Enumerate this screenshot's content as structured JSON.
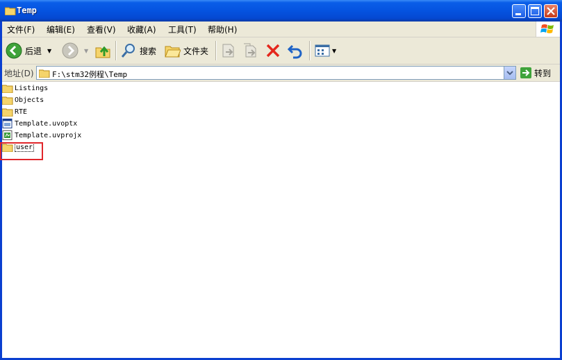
{
  "window": {
    "title": "Temp"
  },
  "menu": [
    "文件(F)",
    "编辑(E)",
    "查看(V)",
    "收藏(A)",
    "工具(T)",
    "帮助(H)"
  ],
  "toolbar": {
    "back_label": "后退",
    "search_label": "搜索",
    "folders_label": "文件夹"
  },
  "address": {
    "label": "地址(D)",
    "value": "F:\\stm32例程\\Temp",
    "go_label": "转到"
  },
  "files": [
    {
      "name": "Listings",
      "type": "folder"
    },
    {
      "name": "Objects",
      "type": "folder"
    },
    {
      "name": "RTE",
      "type": "folder"
    },
    {
      "name": "Template.uvoptx",
      "type": "uvoptx-file"
    },
    {
      "name": "Template.uvprojx",
      "type": "uvprojx-file"
    },
    {
      "name": "user",
      "type": "folder",
      "selected": true
    }
  ],
  "colors": {
    "titlebar": "#0553e0",
    "highlight": "#e0262b",
    "chrome": "#ece9d8"
  }
}
